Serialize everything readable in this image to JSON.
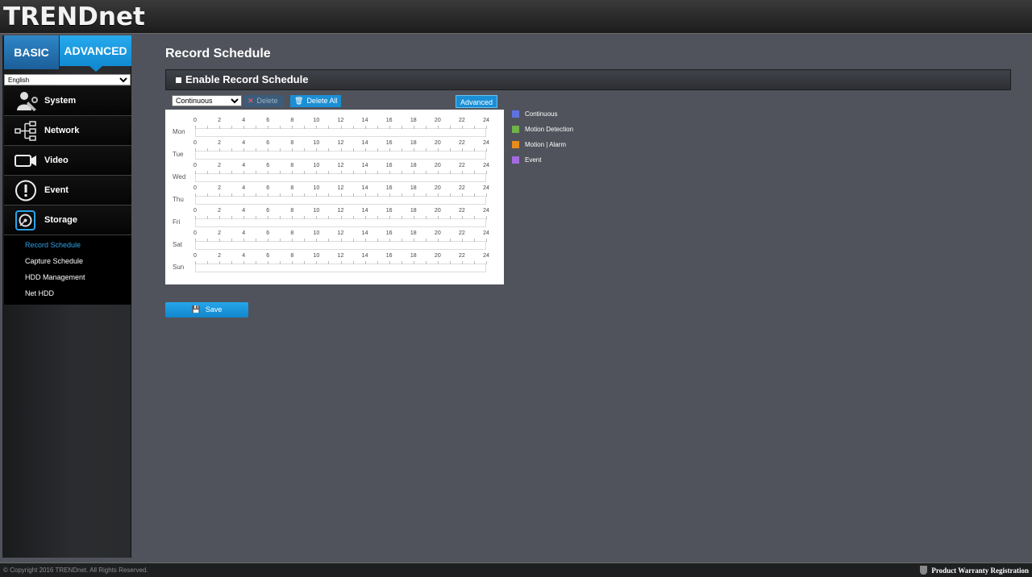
{
  "brand": {
    "logo": "TRENDnet"
  },
  "tabs": {
    "basic": "BASIC",
    "advanced": "ADVANCED"
  },
  "language": {
    "selected": "English"
  },
  "nav": [
    {
      "label": "System",
      "icon": "system-icon"
    },
    {
      "label": "Network",
      "icon": "network-icon"
    },
    {
      "label": "Video",
      "icon": "video-camera-icon"
    },
    {
      "label": "Event",
      "icon": "alert-icon"
    },
    {
      "label": "Storage",
      "icon": "storage-icon"
    }
  ],
  "storage_sub": [
    "Record Schedule",
    "Capture Schedule",
    "HDD Management",
    "Net HDD"
  ],
  "page": {
    "title": "Record Schedule",
    "section": "Enable Record Schedule"
  },
  "toolbar": {
    "type_selected": "Continuous",
    "delete_label": "Delete",
    "delete_all_label": "Delete All",
    "advanced_label": "Advanced"
  },
  "schedule": {
    "days": [
      "Mon",
      "Tue",
      "Wed",
      "Thu",
      "Fri",
      "Sat",
      "Sun"
    ],
    "hours": [
      "0",
      "2",
      "4",
      "6",
      "8",
      "10",
      "12",
      "14",
      "16",
      "18",
      "20",
      "22",
      "24"
    ]
  },
  "legend": [
    {
      "label": "Continuous",
      "color": "#5d72e0"
    },
    {
      "label": "Motion Detection",
      "color": "#6fb34a"
    },
    {
      "label": "Motion | Alarm",
      "color": "#e88a1c"
    },
    {
      "label": "Event",
      "color": "#a46ae2"
    }
  ],
  "save_label": "Save",
  "footer": {
    "copyright": "© Copyright 2016 TRENDnet. All Rights Reserved.",
    "warranty": "Product Warranty Registration"
  }
}
